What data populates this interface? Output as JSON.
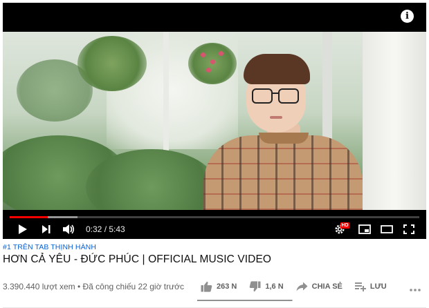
{
  "player": {
    "current_time": "0:32",
    "duration": "5:43",
    "time_separator": " / ",
    "progress_fraction": 0.093,
    "buffered_fraction": 0.165,
    "hd_badge": "HD"
  },
  "video": {
    "hashtag": "#1 TRÊN TAB THỊNH HÀNH",
    "title": "HƠN CẢ YÊU - ĐỨC PHÚC | OFFICIAL MUSIC VIDEO",
    "views": "3.390.440 lượt xem",
    "premiered": " • Đã công chiếu 22 giờ trước"
  },
  "actions": {
    "likes": "263 N",
    "dislikes": "1,6 N",
    "share": "CHIA SẺ",
    "save": "LƯU",
    "like_ratio": 0.994
  },
  "colors": {
    "accent_red": "#ff0000",
    "link_blue": "#065fd4",
    "text_primary": "#0f0f0f",
    "text_secondary": "#606060"
  },
  "icons": [
    "info-icon",
    "play-icon",
    "next-icon",
    "volume-icon",
    "settings-icon",
    "miniplayer-icon",
    "theater-icon",
    "fullscreen-icon",
    "thumb-up-icon",
    "thumb-down-icon",
    "share-icon",
    "playlist-add-icon",
    "more-icon"
  ]
}
